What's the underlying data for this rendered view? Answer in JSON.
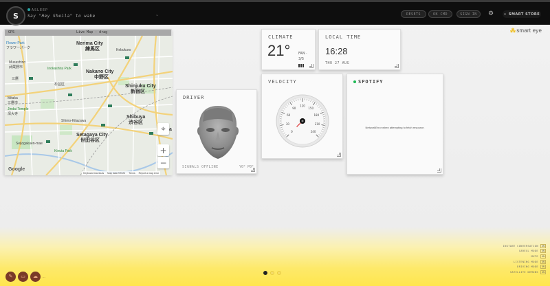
{
  "topbar": {
    "avatar_letter": "S",
    "status": "ASLEEP",
    "wake_hint": "Say \"Hey Sheila\" to wake",
    "mic_dropdown_glyph": "⌄",
    "buttons": {
      "resets": "RESETS",
      "ok_cmd": "OK CMD",
      "sign_in": "SIGN IN"
    },
    "settings_icon": "gear-icon",
    "store_label": "SMART STORE"
  },
  "logo": {
    "text": "smart eye"
  },
  "gps": {
    "title": "GPS",
    "mode": "Live Map - drag",
    "labels": {
      "flower_park": "Flower Park",
      "flower_park_jp": "フラワーパーク",
      "nerima": "Nerima City",
      "nerima_jp": "練馬区",
      "kebukuro": "Kebukuro",
      "musashino": "Musashino",
      "musashino_jp": "武蔵野市",
      "mitaka_jp1": "三鷹",
      "nakano": "Nakano City",
      "nakano_jp": "中野区",
      "inokashira": "Inokashira Park",
      "suginami_jp": "杉並区",
      "shinjuku": "Shinjuku City",
      "shinjuku_jp": "新宿区",
      "mitaka": "Mitaka",
      "mitaka_jp": "三鷹市",
      "jindai": "Jindai Temple",
      "jindai_jp": "深大寺",
      "shibuya": "Shibuya",
      "shibuya_jp": "渋谷区",
      "kitazawa": "Shimo-Kitazawa",
      "setagaya": "Setagaya City",
      "setagaya_jp": "世田谷区",
      "setagaya_park": "Kinuta Park",
      "sengakuji": "Seijogakuen-mae",
      "mina": "Mina"
    },
    "google": "Google",
    "footer": [
      "Keyboard shortcuts",
      "Map data ©2024",
      "Terms",
      "Report a map error"
    ],
    "zoom_in": "+",
    "zoom_out": "−",
    "locate_icon": "⌖"
  },
  "driver": {
    "title": "DRIVER",
    "status": "SIGNALS OFFLINE",
    "angle": "Y0° P0°"
  },
  "climate": {
    "title": "CLIMATE",
    "temperature": "21°",
    "fan_label": "FAN ·",
    "fan_level": "3/5"
  },
  "time": {
    "title": "LOCAL TIME",
    "value": "16:28",
    "date": "THU 27 AUG"
  },
  "velocity": {
    "title": "VELOCITY",
    "ticks": [
      "0",
      "30",
      "60",
      "90",
      "120",
      "150",
      "180",
      "210",
      "240"
    ],
    "value": 0,
    "max": 240
  },
  "spotify": {
    "title": "SPOTIFY",
    "error": "NetworkError when attempting to fetch resource."
  },
  "modes": [
    {
      "label": "INSTANT CONVERSATION",
      "value": "ON"
    },
    {
      "label": "CAREGL MODE",
      "value": "ON"
    },
    {
      "label": "MUTE",
      "value": "ON"
    },
    {
      "label": "LISTENING MODE",
      "value": "ON"
    },
    {
      "label": "DRIVING MODE",
      "value": "ON"
    },
    {
      "label": "SATELLITE DEMONS",
      "value": "ON"
    }
  ],
  "bottom_left": {
    "buttons": [
      "edit-icon",
      "video-icon",
      "cloud-icon"
    ],
    "more": "···"
  },
  "pager": {
    "count": 3,
    "active": 0
  },
  "colors": {
    "topbar_bg": "#0e0e0e",
    "accent_yellow": "#ffe64e",
    "spotify_green": "#1db954",
    "status_teal": "#2aa6a6"
  }
}
